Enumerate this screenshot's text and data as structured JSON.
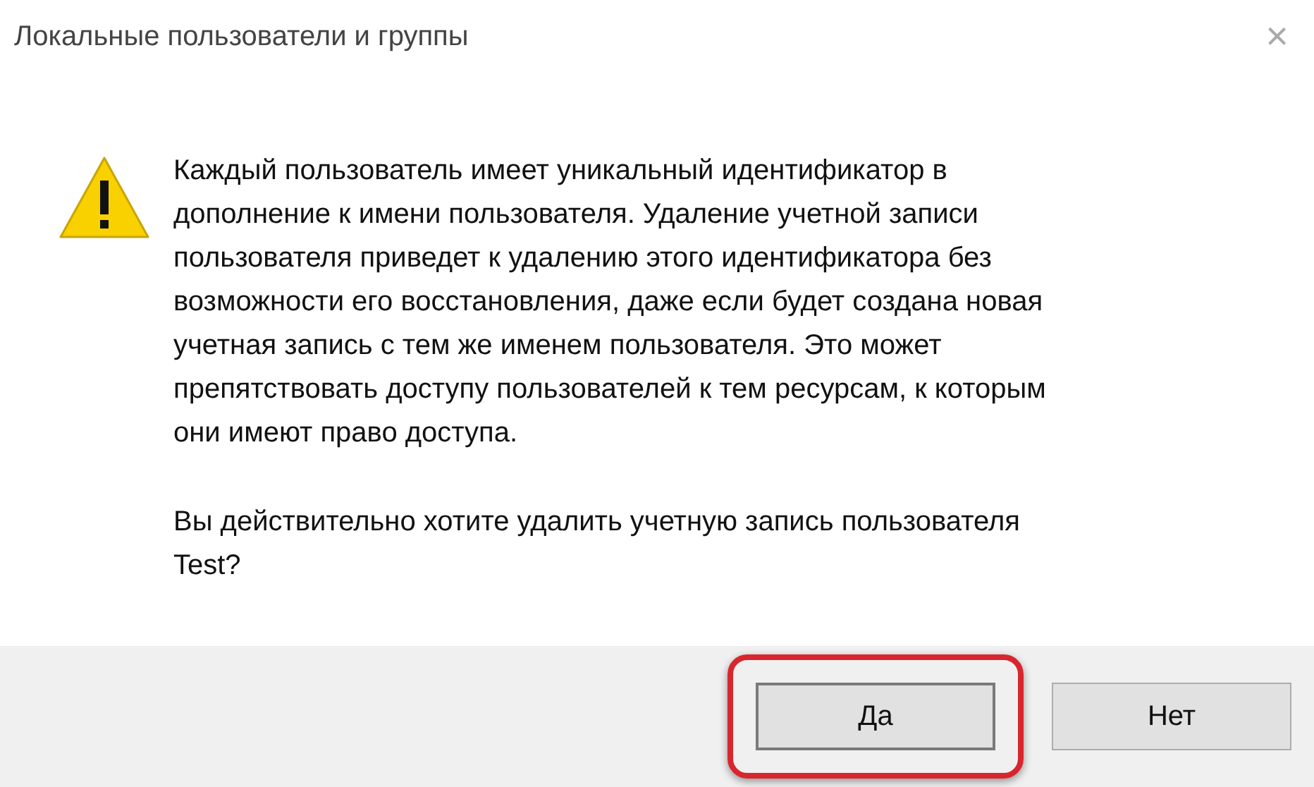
{
  "window": {
    "title": "Локальные пользователи и группы",
    "close": "×"
  },
  "message": {
    "paragraphs": [
      [
        "Каждый пользователь имеет уникальный идентификатор в",
        "дополнение к имени пользователя. Удаление учетной записи",
        "пользователя приведет к удалению этого идентификатора без",
        "возможности его восстановления, даже если будет создана новая",
        "учетная запись с тем же именем пользователя. Это может",
        "препятствовать доступу пользователей к тем ресурсам, к которым",
        "они имеют право доступа."
      ],
      [
        "Вы действительно хотите удалить учетную запись пользователя",
        "Test?"
      ]
    ]
  },
  "buttons": [
    {
      "label": "Да",
      "highlighted": true
    },
    {
      "label": "Нет",
      "highlighted": false
    }
  ]
}
